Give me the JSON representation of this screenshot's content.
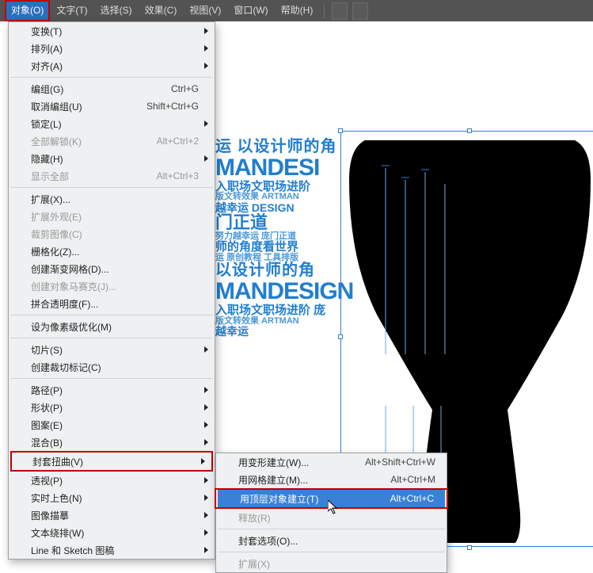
{
  "menubar": {
    "items": [
      {
        "label": "对象(O)",
        "active": true
      },
      {
        "label": "文字(T)"
      },
      {
        "label": "选择(S)"
      },
      {
        "label": "效果(C)"
      },
      {
        "label": "视图(V)"
      },
      {
        "label": "窗口(W)"
      },
      {
        "label": "帮助(H)"
      }
    ]
  },
  "menu": [
    {
      "label": "变换(T)",
      "sub": true
    },
    {
      "label": "排列(A)",
      "sub": true
    },
    {
      "label": "对齐(A)",
      "sub": true
    },
    {
      "hr": true
    },
    {
      "label": "编组(G)",
      "shortcut": "Ctrl+G"
    },
    {
      "label": "取消编组(U)",
      "shortcut": "Shift+Ctrl+G"
    },
    {
      "label": "锁定(L)",
      "sub": true
    },
    {
      "label": "全部解锁(K)",
      "shortcut": "Alt+Ctrl+2",
      "disabled": true
    },
    {
      "label": "隐藏(H)",
      "sub": true
    },
    {
      "label": "显示全部",
      "shortcut": "Alt+Ctrl+3",
      "disabled": true
    },
    {
      "hr": true
    },
    {
      "label": "扩展(X)..."
    },
    {
      "label": "扩展外观(E)",
      "disabled": true
    },
    {
      "label": "裁剪图像(C)",
      "disabled": true
    },
    {
      "label": "栅格化(Z)..."
    },
    {
      "label": "创建渐变网格(D)..."
    },
    {
      "label": "创建对象马赛克(J)...",
      "disabled": true
    },
    {
      "label": "拼合透明度(F)..."
    },
    {
      "hr": true
    },
    {
      "label": "设为像素级优化(M)"
    },
    {
      "hr": true
    },
    {
      "label": "切片(S)",
      "sub": true
    },
    {
      "label": "创建裁切标记(C)"
    },
    {
      "hr": true
    },
    {
      "label": "路径(P)",
      "sub": true
    },
    {
      "label": "形状(P)",
      "sub": true
    },
    {
      "label": "图案(E)",
      "sub": true
    },
    {
      "label": "混合(B)",
      "sub": true
    },
    {
      "label": "封套扭曲(V)",
      "sub": true,
      "highlight": true
    },
    {
      "label": "透视(P)",
      "sub": true
    },
    {
      "label": "实时上色(N)",
      "sub": true
    },
    {
      "label": "图像描摹",
      "sub": true
    },
    {
      "label": "文本绕排(W)",
      "sub": true
    },
    {
      "label": "Line 和 Sketch 图稿",
      "sub": true
    }
  ],
  "submenu": [
    {
      "label": "用变形建立(W)...",
      "shortcut": "Alt+Shift+Ctrl+W"
    },
    {
      "label": "用网格建立(M)...",
      "shortcut": "Alt+Ctrl+M"
    },
    {
      "label": "用顶层对象建立(T)",
      "shortcut": "Alt+Ctrl+C",
      "selected": true,
      "highlight": true
    },
    {
      "label": "释放(R)",
      "disabled": true
    },
    {
      "hr": true
    },
    {
      "label": "封套选项(O)..."
    },
    {
      "hr": true
    },
    {
      "label": "扩展(X)",
      "disabled": true
    }
  ],
  "canvas_text": {
    "a": "运 以设计师的角",
    "b": "MANDESI",
    "c": "入职场文职场进阶",
    "d": "版文转效果 ARTMAN",
    "e": "越幸运 DESIGN",
    "f": "门正道",
    "g": "努力越幸运 庞门正道",
    "h": "师的角度看世界",
    "i": "运 原创教程 工具排版",
    "j": "以设计师的角",
    "k": "MANDESIGN",
    "l": "入职场文职场进阶 庞",
    "m": "版文转效果 ARTMAN",
    "n": "越幸运"
  }
}
